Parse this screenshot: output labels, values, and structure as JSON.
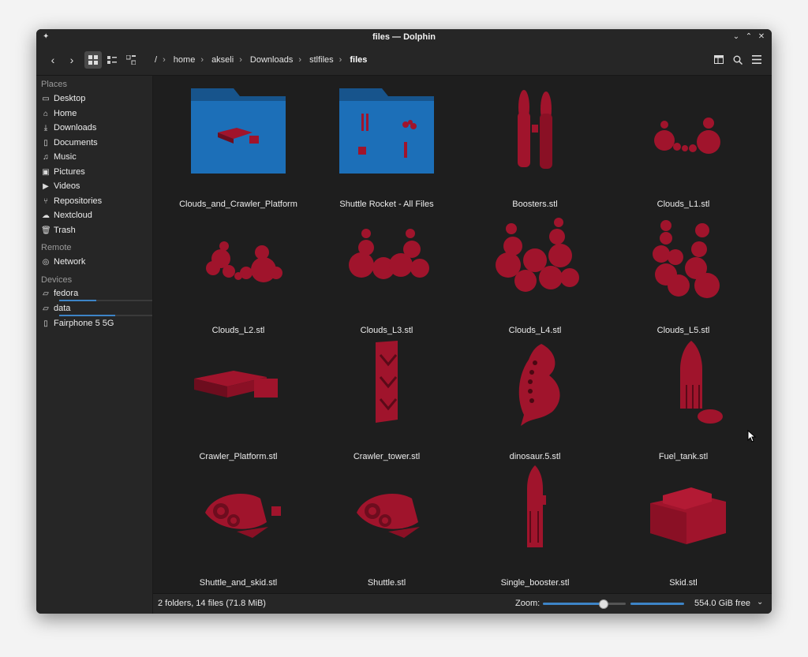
{
  "window": {
    "title": "files — Dolphin"
  },
  "toolbar": {
    "breadcrumb": [
      "/",
      "home",
      "akseli",
      "Downloads",
      "stlfiles",
      "files"
    ]
  },
  "sidebar": {
    "places_label": "Places",
    "places": [
      {
        "label": "Desktop",
        "icon": "desktop-icon"
      },
      {
        "label": "Home",
        "icon": "home-icon"
      },
      {
        "label": "Downloads",
        "icon": "download-icon"
      },
      {
        "label": "Documents",
        "icon": "document-icon"
      },
      {
        "label": "Music",
        "icon": "music-icon"
      },
      {
        "label": "Pictures",
        "icon": "pictures-icon"
      },
      {
        "label": "Videos",
        "icon": "videos-icon"
      },
      {
        "label": "Repositories",
        "icon": "repositories-icon"
      },
      {
        "label": "Nextcloud",
        "icon": "cloud-icon"
      },
      {
        "label": "Trash",
        "icon": "trash-icon"
      }
    ],
    "remote_label": "Remote",
    "remote": [
      {
        "label": "Network",
        "icon": "network-icon"
      }
    ],
    "devices_label": "Devices",
    "devices": [
      {
        "label": "fedora",
        "icon": "drive-icon",
        "usage": 0.4
      },
      {
        "label": "data",
        "icon": "drive-icon",
        "usage": 0.6
      },
      {
        "label": "Fairphone 5 5G",
        "icon": "phone-icon"
      }
    ]
  },
  "files": [
    {
      "name": "Clouds_and_Crawler_Platform",
      "type": "folder"
    },
    {
      "name": "Shuttle Rocket - All Files",
      "type": "folder"
    },
    {
      "name": "Boosters.stl",
      "type": "stl"
    },
    {
      "name": "Clouds_L1.stl",
      "type": "stl"
    },
    {
      "name": "Clouds_L2.stl",
      "type": "stl"
    },
    {
      "name": "Clouds_L3.stl",
      "type": "stl"
    },
    {
      "name": "Clouds_L4.stl",
      "type": "stl"
    },
    {
      "name": "Clouds_L5.stl",
      "type": "stl"
    },
    {
      "name": "Crawler_Platform.stl",
      "type": "stl"
    },
    {
      "name": "Crawler_tower.stl",
      "type": "stl"
    },
    {
      "name": "dinosaur.5.stl",
      "type": "stl"
    },
    {
      "name": "Fuel_tank.stl",
      "type": "stl"
    },
    {
      "name": "Shuttle_and_skid.stl",
      "type": "stl"
    },
    {
      "name": "Shuttle.stl",
      "type": "stl"
    },
    {
      "name": "Single_booster.stl",
      "type": "stl"
    },
    {
      "name": "Skid.stl",
      "type": "stl"
    }
  ],
  "status": {
    "summary": "2 folders, 14 files (71.8 MiB)",
    "zoom_label": "Zoom:",
    "zoom_level": 0.72,
    "free_space": "554.0 GiB free"
  },
  "colors": {
    "accent": "#3d84c7",
    "model": "#a0142c",
    "folder": "#1c6fb8"
  }
}
